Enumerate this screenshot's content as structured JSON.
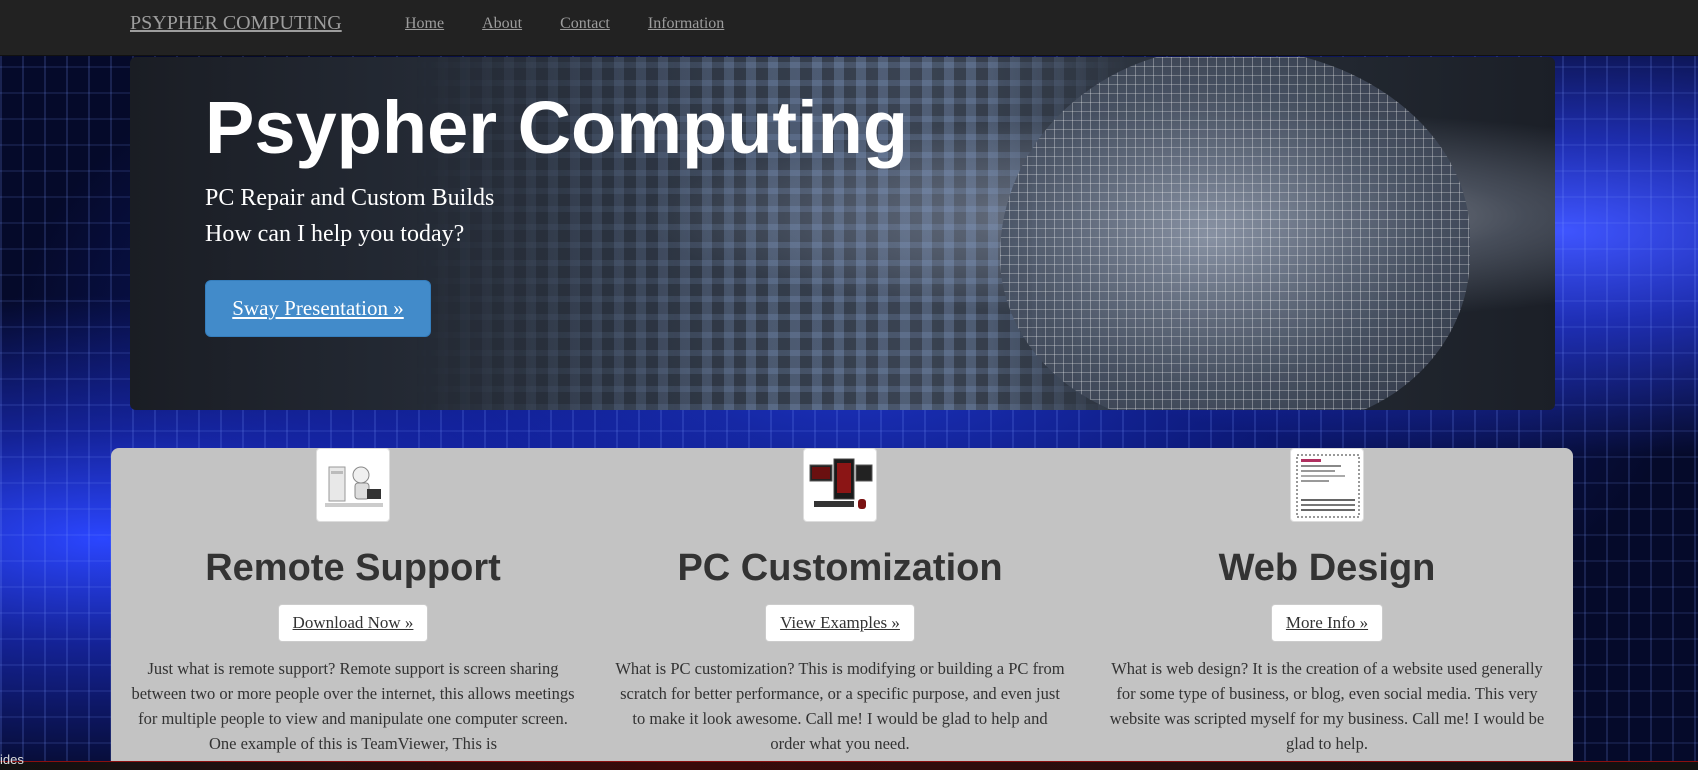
{
  "navbar": {
    "brand": "PSYPHER COMPUTING",
    "links": [
      "Home",
      "About",
      "Contact",
      "Information"
    ]
  },
  "hero": {
    "title": "Psypher Computing",
    "subtitle_line1": "PC Repair and Custom Builds",
    "subtitle_line2": "How can I help you today?",
    "button_label": "Sway Presentation »",
    "button_color": "#428bca"
  },
  "services": [
    {
      "icon": "remote-support-icon",
      "title": "Remote Support",
      "button_label": "Download Now »",
      "text": "Just what is remote support? Remote support is screen sharing between two or more people over the internet, this allows meetings for multiple people to view and manipulate one computer screen. One example of this is TeamViewer, This is"
    },
    {
      "icon": "pc-setup-icon",
      "title": "PC Customization",
      "button_label": "View Examples »",
      "text": "What is PC customization? This is modifying or building a PC from scratch for better performance, or a specific purpose, and even just to make it look awesome. Call me! I would be glad to help and order what you need."
    },
    {
      "icon": "webpage-document-icon",
      "title": "Web Design",
      "button_label": "More Info »",
      "text": "What is web design? It is the creation of a website used generally for some type of business, or blog, even social media. This very website was scripted myself for my business. Call me! I would be glad to help."
    }
  ],
  "footer_fragment": "ides",
  "colors": {
    "navbar_bg": "#222222",
    "panel_bg": "#c3c3c3",
    "background_accent": "#2b46ff"
  }
}
